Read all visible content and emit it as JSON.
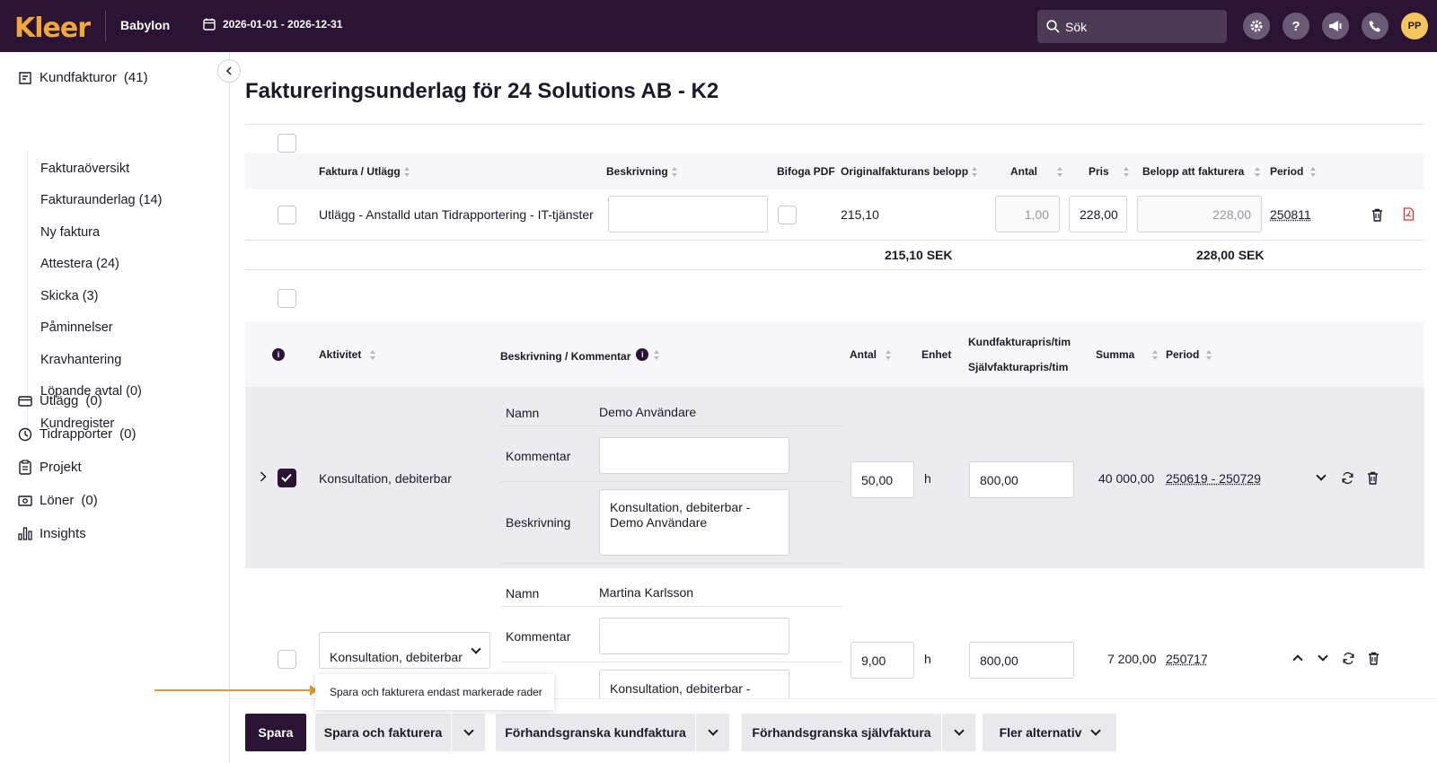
{
  "topbar": {
    "logo": "Kleer",
    "company": "Babylon",
    "date_range": "2026-01-01 - 2026-12-31",
    "search_placeholder": "Sök",
    "avatar_initials": "PP",
    "icons": [
      "gear-icon",
      "help-icon",
      "megaphone-icon",
      "phone-icon"
    ]
  },
  "sidebar": {
    "kundfakturor": "Kundfakturor",
    "kundfakturor_count": "(41)",
    "items": [
      "Fakturaöversikt",
      "Fakturaunderlag (14)",
      "Ny faktura",
      "Attestera (24)",
      "Skicka (3)",
      "Påminnelser",
      "Kravhantering",
      "Löpande avtal (0)",
      "Kundregister"
    ],
    "utlagg": "Utlägg",
    "utlagg_count": "(0)",
    "tidrapporter": "Tidrapporter",
    "tidrapporter_count": "(0)",
    "projekt": "Projekt",
    "loner": "Löner",
    "loner_count": "(0)",
    "insights": "Insights"
  },
  "page": {
    "title": "Faktureringsunderlag för 24 Solutions AB - K2"
  },
  "expense_table": {
    "headers": {
      "faktura": "Faktura / Utlägg",
      "beskrivning": "Beskrivning",
      "bifoga": "Bifoga PDF",
      "original": "Originalfakturans belopp",
      "antal": "Antal",
      "pris": "Pris",
      "belopp": "Belopp att fakturera",
      "period": "Period"
    },
    "row": {
      "name": "Utlägg - Anstalld utan Tidrapportering - IT-tjänster",
      "description": "",
      "original": "215,10",
      "antal": "1,00",
      "pris": "228,00",
      "belopp": "228,00",
      "period": "250811"
    },
    "totals": {
      "original": "215,10 SEK",
      "belopp": "228,00 SEK"
    }
  },
  "activity_table": {
    "headers": {
      "aktivitet": "Aktivitet",
      "beskrivning": "Beskrivning / Kommentar",
      "antal": "Antal",
      "enhet": "Enhet",
      "kundpris": "Kundfakturapris/tim",
      "sjalvpris": "Självfakturapris/tim",
      "summa": "Summa",
      "period": "Period"
    },
    "labels": {
      "namn": "Namn",
      "kommentar": "Kommentar",
      "beskrivning": "Beskrivning"
    },
    "rows": [
      {
        "activity": "Konsultation, debiterbar",
        "namn": "Demo Användare",
        "kommentar": "",
        "beskrivning": "Konsultation, debiterbar - Demo Användare",
        "antal": "50,00",
        "enhet": "h",
        "pris": "800,00",
        "summa": "40 000,00",
        "period": "250619 - 250729"
      },
      {
        "activity": "Konsultation, debiterbar",
        "namn": "Martina Karlsson",
        "kommentar": "",
        "beskrivning": "Konsultation, debiterbar -",
        "antal": "9,00",
        "enhet": "h",
        "pris": "800,00",
        "summa": "7 200,00",
        "period": "250717"
      }
    ]
  },
  "tooltip": "Spara och fakturera endast markerade rader",
  "actions": {
    "save": "Spara",
    "save_invoice": "Spara och fakturera",
    "preview_customer": "Förhandsgranska kundfaktura",
    "preview_self": "Förhandsgranska självfaktura",
    "more": "Fler alternativ"
  },
  "colors": {
    "brand_dark": "#2a1335",
    "logo_orange": "#f0a83a",
    "arrow": "#e6962e",
    "pdf_red": "#d9342b"
  }
}
